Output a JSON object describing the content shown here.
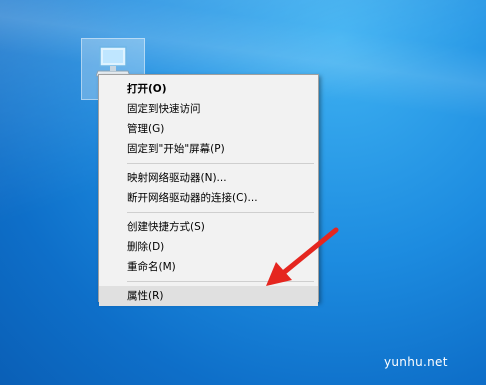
{
  "desktop": {
    "icon_name": "computer-icon"
  },
  "context_menu": {
    "items_group1": [
      {
        "label": "打开(O)",
        "bold": true
      },
      {
        "label": "固定到快速访问"
      },
      {
        "label": "管理(G)"
      },
      {
        "label": "固定到\"开始\"屏幕(P)"
      }
    ],
    "items_group2": [
      {
        "label": "映射网络驱动器(N)..."
      },
      {
        "label": "断开网络驱动器的连接(C)..."
      }
    ],
    "items_group3": [
      {
        "label": "创建快捷方式(S)"
      },
      {
        "label": "删除(D)"
      },
      {
        "label": "重命名(M)"
      }
    ],
    "items_group4": [
      {
        "label": "属性(R)"
      }
    ]
  },
  "annotation": {
    "arrow_color": "#e5261f"
  },
  "watermark": {
    "text": "yunhu.net"
  }
}
